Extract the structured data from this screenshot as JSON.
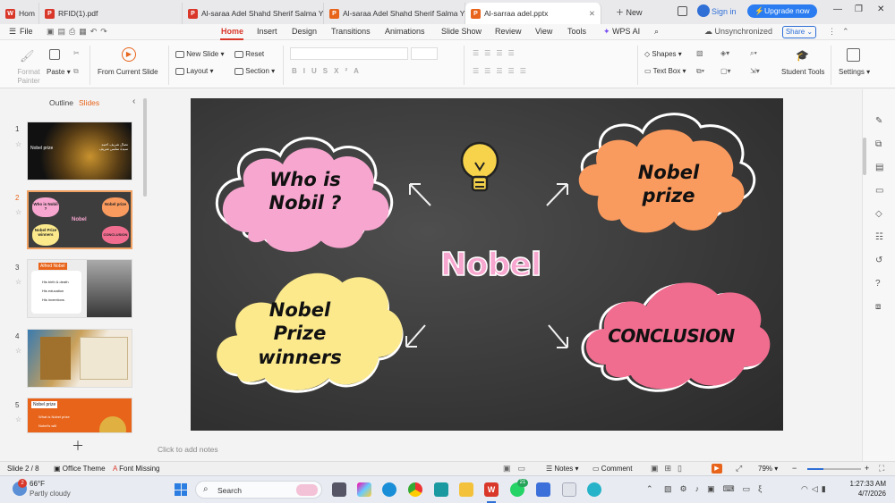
{
  "tabs": [
    {
      "label": "Hom",
      "icon": "wps-home-icon",
      "color": "#d9372a"
    },
    {
      "label": "RFID(1).pdf",
      "icon": "pdf-icon",
      "color": "#d9372a"
    },
    {
      "label": "Al-saraa Adel Shahd Sherif Salma Ya",
      "icon": "pdf-icon",
      "color": "#d9372a"
    },
    {
      "label": "Al-saraa Adel Shahd Sherif Salma Ya",
      "icon": "presentation-icon",
      "color": "#e8641b"
    },
    {
      "label": "Al-sarraa adel.pptx",
      "icon": "presentation-icon",
      "color": "#e8641b"
    }
  ],
  "window": {
    "new_label": "New",
    "sign_in": "Sign in",
    "upgrade": "Upgrade now"
  },
  "menus": {
    "file": "File",
    "items": [
      "Home",
      "Insert",
      "Design",
      "Transitions",
      "Animations",
      "Slide Show",
      "Review",
      "View",
      "Tools",
      "WPS AI"
    ],
    "unsync": "Unsynchronized",
    "share": "Share"
  },
  "ribbon": {
    "format_painter": "Format Painter",
    "paste": "Paste",
    "from_current": "From Current Slide",
    "new_slide": "New  Slide",
    "reset": "Reset",
    "layout": "Layout",
    "section": "Section",
    "shapes": "Shapes",
    "textbox": "Text Box",
    "student_tools": "Student Tools",
    "settings": "Settings"
  },
  "panel": {
    "outline": "Outline",
    "slides": "Slides"
  },
  "thumbs": [
    {
      "num": "1",
      "title": "Nobel prize",
      "sub": "نضال شريف احمد سيدة سلمى شريف"
    },
    {
      "num": "2",
      "a": "Who is Nobil ?",
      "b": "Nobel prize",
      "c": "Nobel Prize winners",
      "d": "CONCLUSION",
      "center": "Nobel"
    },
    {
      "num": "3",
      "title": "Alfred Nobel",
      "items": [
        "His birth & death",
        "His education",
        "His inventions"
      ]
    },
    {
      "num": "4"
    },
    {
      "num": "5",
      "title": "Nobel prize",
      "items": [
        "What is Nobel prize",
        "Nobel's will"
      ]
    }
  ],
  "slide": {
    "top_left": "Who is\nNobil ?",
    "top_right": "Nobel\nprize",
    "bottom_left": "Nobel\nPrize\nwinners",
    "bottom_right": "CONCLUSION",
    "center": "Nobel"
  },
  "notes_placeholder": "Click to add notes",
  "status": {
    "slide": "Slide 2 / 8",
    "theme": "Office Theme",
    "font": "Font Missing",
    "notes": "Notes",
    "comment": "Comment",
    "zoom": "79%"
  },
  "taskbar": {
    "temp": "66°F",
    "weather": "Partly cloudy",
    "search": "Search",
    "time": "1:27:33 AM",
    "date": "4/7/2026",
    "badge": "21"
  },
  "colors": {
    "pink": "#f7a6cf",
    "orange": "#f99a5f",
    "yellow": "#fbe98c",
    "coral": "#f06d8f",
    "accent": "#d9372a"
  }
}
